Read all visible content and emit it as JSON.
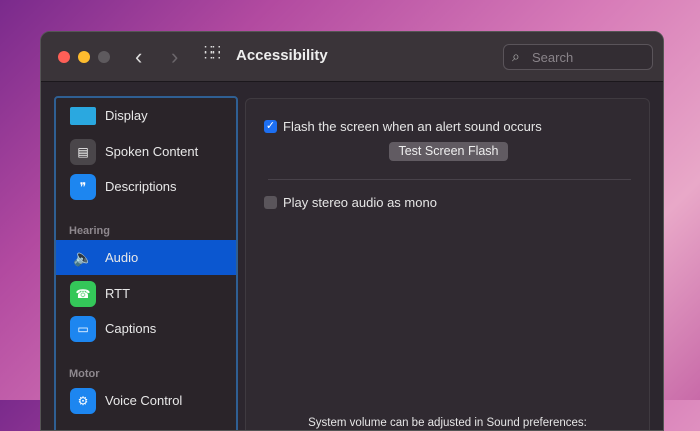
{
  "window": {
    "title": "Accessibility",
    "search_placeholder": "Search"
  },
  "sidebar": {
    "items": [
      {
        "label": "Display",
        "icon": "display-icon",
        "color": "#2aa8e0"
      },
      {
        "label": "Spoken Content",
        "icon": "spoken-content-icon",
        "color": "#4a464a"
      },
      {
        "label": "Descriptions",
        "icon": "descriptions-icon",
        "color": "#1d86f0"
      },
      {
        "label": "Audio",
        "icon": "speaker-icon",
        "color": "#cccccc",
        "selected": true
      },
      {
        "label": "RTT",
        "icon": "rtt-phone-icon",
        "color": "#34c759"
      },
      {
        "label": "Captions",
        "icon": "captions-icon",
        "color": "#1d86f0"
      },
      {
        "label": "Voice Control",
        "icon": "voice-control-icon",
        "color": "#1d86f0"
      }
    ],
    "sections": {
      "hearing": "Hearing",
      "motor": "Motor"
    }
  },
  "content": {
    "flash_checkbox": {
      "label": "Flash the screen when an alert sound occurs",
      "checked": true
    },
    "test_button": "Test Screen Flash",
    "mono_checkbox": {
      "label": "Play stereo audio as mono",
      "checked": false
    },
    "footer_text": "System volume can be adjusted in Sound preferences:"
  },
  "colors": {
    "accent": "#0b57d0"
  }
}
